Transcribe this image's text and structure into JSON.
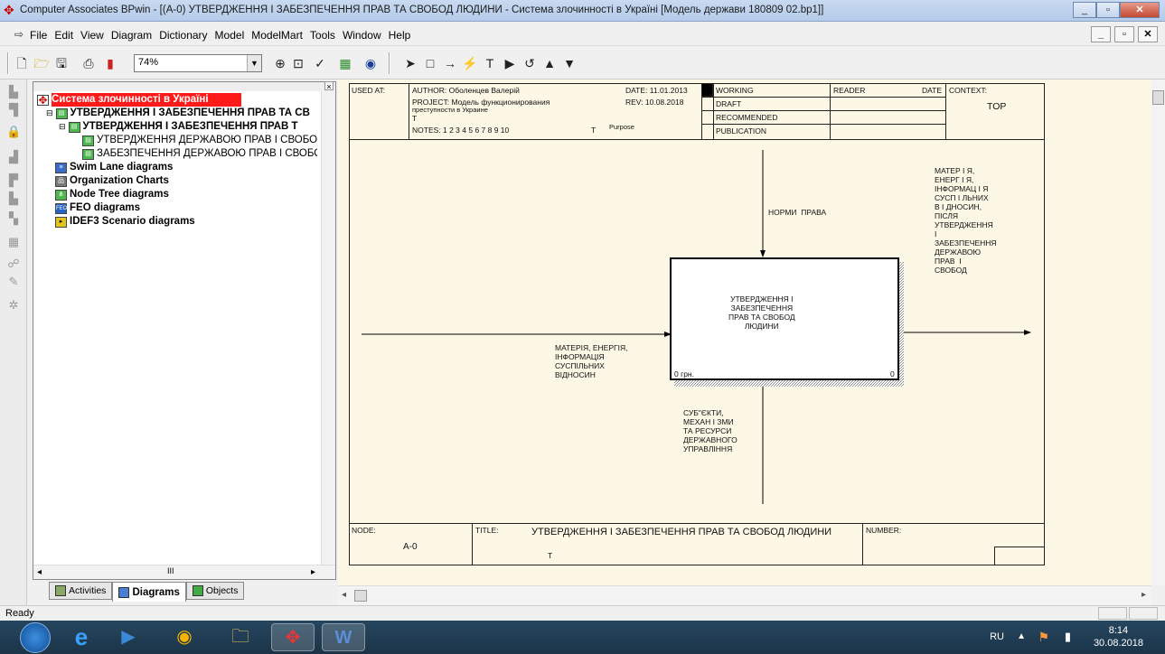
{
  "window": {
    "title": "Computer Associates BPwin - [(A-0) УТВЕРДЖЕННЯ І  ЗАБЕЗПЕЧЕННЯ ПРАВ ТА СВОБОД  ЛЮДИНИ - Система злочинності в Україні  [Модель держави 180809 02.bp1]]",
    "controls": [
      "_",
      "▫",
      "✕"
    ]
  },
  "menu": {
    "items": [
      "File",
      "Edit",
      "View",
      "Diagram",
      "Dictionary",
      "Model",
      "ModelMart",
      "Tools",
      "Window",
      "Help"
    ],
    "mdi_controls": [
      "_",
      "▫",
      "✕"
    ]
  },
  "toolbar": {
    "zoom": "74%"
  },
  "explorer": {
    "items": [
      {
        "label": "Система злочинності в Україні",
        "icon": "model-icon",
        "selected": true,
        "bold": true
      },
      {
        "label": "УТВЕРДЖЕННЯ І  ЗАБЕЗПЕЧЕННЯ ПРАВ ТА СВ",
        "icon": "diagram-icon",
        "bold": true
      },
      {
        "label": "УТВЕРДЖЕННЯ І  ЗАБЕЗПЕЧЕННЯ ПРАВ Т",
        "icon": "diagram-icon",
        "bold": true
      },
      {
        "label": "УТВЕРДЖЕННЯ  ДЕРЖАВОЮ ПРАВ  І СВОБОД",
        "icon": "diagram-icon",
        "bold": false
      },
      {
        "label": "ЗАБЕЗПЕЧЕННЯ  ДЕРЖАВОЮ ПРАВ І СВОБОД",
        "icon": "diagram-icon",
        "bold": false
      },
      {
        "label": "Swim Lane diagrams",
        "icon": "swimlane-icon",
        "bold": true
      },
      {
        "label": "Organization Charts",
        "icon": "org-chart-icon",
        "bold": true
      },
      {
        "label": "Node Tree diagrams",
        "icon": "node-tree-icon",
        "bold": true
      },
      {
        "label": "FEO diagrams",
        "icon": "feo-icon",
        "bold": true
      },
      {
        "label": "IDEF3 Scenario diagrams",
        "icon": "idef3-icon",
        "bold": true
      }
    ],
    "hscroll_thumb": "III",
    "tabs": [
      "Activities",
      "Diagrams",
      "Objects"
    ]
  },
  "diagram": {
    "header": {
      "used_at": "USED AT:",
      "author": "AUTHOR:  Оболенцев Валерій",
      "project": "PROJECT:  Модель функционирования",
      "project2": "преступности в Украине",
      "t1": "T",
      "notes": "NOTES:  1  2  3  4  5  6  7  8  9  10",
      "t2": "T",
      "date": "DATE: 11.01.2013",
      "rev": "REV:  10.08.2018",
      "purpose": "Purpose",
      "working": "WORKING",
      "draft": "DRAFT",
      "recommended": "RECOMMENDED",
      "publication": "PUBLICATION",
      "reader": "READER",
      "date_col": "DATE",
      "context": "CONTEXT:",
      "top": "TOP"
    },
    "activity": {
      "name": "УТВЕРДЖЕННЯ І\nЗАБЕЗПЕЧЕННЯ\nПРАВ ТА СВОБОД\nЛЮДИНИ",
      "cost": "0 грн.",
      "number": "0"
    },
    "arrows": {
      "control": "НОРМИ  ПРАВА",
      "input": "МАТЕРІЯ, ЕНЕРГІЯ,\nІНФОРМАЦІЯ\nСУСПІЛЬНИХ\nВІДНОСИН",
      "output": "МАТЕР І Я,\nЕНЕРГ І Я,\nІНФОРМАЦ І Я\nСУСП І ЛЬНИХ\nВ І ДНОСИН,\nПІСЛЯ\nУТВЕРДЖЕННЯ\nІ\nЗАБЕЗПЕЧЕННЯ\nДЕРЖАВОЮ\nПРАВ  І\nСВОБОД",
      "mechanism": "СУБ\"ЄКТИ,\nМЕХАН І ЗМИ\nТА РЕСУРСИ\nДЕРЖАВНОГО\nУПРАВЛІННЯ"
    },
    "footer": {
      "node": "NODE:",
      "node_value": "A-0",
      "title": "TITLE:",
      "title_value": "УТВЕРДЖЕННЯ І  ЗАБЕЗПЕЧЕННЯ ПРАВ ТА СВОБОД  ЛЮДИНИ",
      "t": "T",
      "number": "NUMBER:"
    }
  },
  "status": {
    "text": "Ready"
  },
  "taskbar": {
    "lang": "RU",
    "time": "8:14",
    "date": "30.08.2018"
  }
}
